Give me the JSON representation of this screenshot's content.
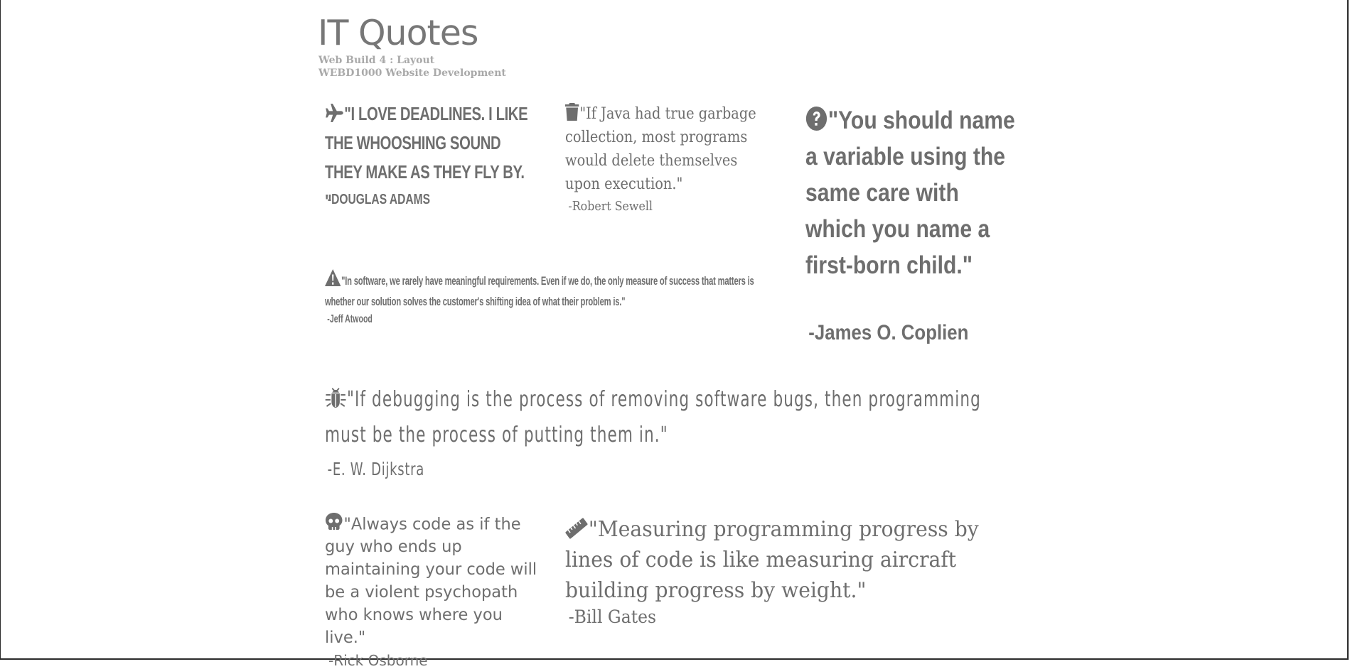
{
  "header": {
    "title": "IT Quotes",
    "subtitle_line1": "Web Build 4 : Layout",
    "subtitle_line2": "WEBD1000 Website Development"
  },
  "quotes": [
    {
      "icon": "plane-icon",
      "text": "\"I love deadlines. I like the whooshing sound they make as they fly by. \"",
      "author": "-Douglas Adams"
    },
    {
      "icon": "trash-icon",
      "text": "\"If Java had true garbage collection, most programs would delete themselves upon execution.\"",
      "author": "-Robert Sewell"
    },
    {
      "icon": "question-circle-icon",
      "text": "\"You should name a variable using the same care with which you name a first-born child.\"",
      "author": "-James O. Coplien"
    },
    {
      "icon": "warning-icon",
      "text": "\"In software, we rarely have meaningful requirements. Even if we do, the only measure of success that matters is whether our solution solves the customer's shifting idea of what their problem is.\"",
      "author": "-Jeff Atwood"
    },
    {
      "icon": "bug-icon",
      "text": "\"If debugging is the process of removing software bugs, then programming must be the process of putting them in.\"",
      "author": "-E. W. Dijkstra"
    },
    {
      "icon": "skull-icon",
      "text": "\"Always code as if the guy who ends up maintaining your code will be a violent psychopath who knows where you live.\"",
      "author": "-Rick Osborne"
    },
    {
      "icon": "ruler-icon",
      "text": "\"Measuring programming progress by lines of code is like measuring aircraft building progress by weight.\"",
      "author": "-Bill Gates"
    }
  ]
}
